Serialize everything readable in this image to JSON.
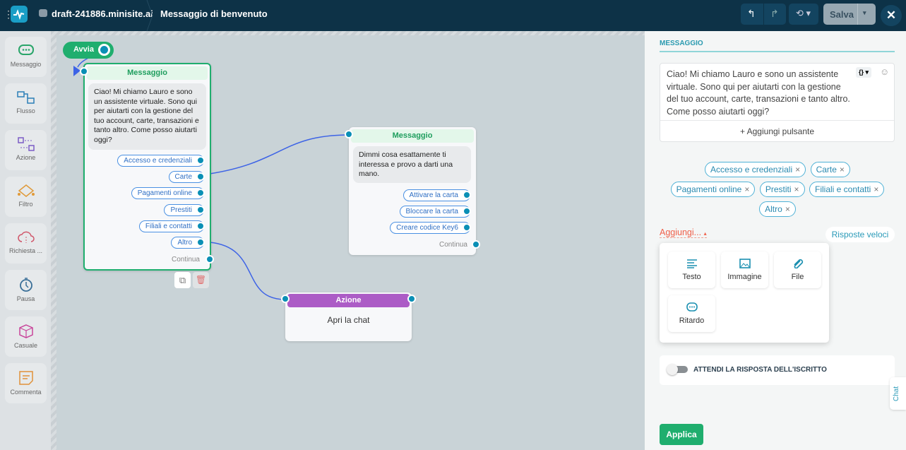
{
  "header": {
    "site": "draft-241886.minisite.ai",
    "page_title": "Messaggio di benvenuto",
    "save_label": "Salva"
  },
  "sidebar": {
    "items": [
      {
        "label": "Messaggio",
        "icon": "chat-bubble-icon"
      },
      {
        "label": "Flusso",
        "icon": "flow-icon"
      },
      {
        "label": "Azione",
        "icon": "action-icon"
      },
      {
        "label": "Filtro",
        "icon": "filter-icon"
      },
      {
        "label": "Richiesta ...",
        "icon": "cloud-request-icon"
      },
      {
        "label": "Pausa",
        "icon": "timer-icon"
      },
      {
        "label": "Casuale",
        "icon": "dice-icon"
      },
      {
        "label": "Commenta",
        "icon": "note-icon"
      }
    ]
  },
  "canvas": {
    "start_label": "Avvia",
    "node1": {
      "title": "Messaggio",
      "text": "Ciao! Mi chiamo Lauro e sono un assistente virtuale. Sono qui per aiutarti con la gestione del tuo account, carte, transazioni e tanto altro. Come posso aiutarti oggi?",
      "buttons": [
        "Accesso e credenziali",
        "Carte",
        "Pagamenti online",
        "Prestiti",
        "Filiali e contatti",
        "Altro"
      ],
      "continue": "Continua"
    },
    "node2": {
      "title": "Messaggio",
      "text": "Dimmi cosa esattamente ti interessa e provo a darti una mano.",
      "buttons": [
        "Attivare la carta",
        "Bloccare la carta",
        "Creare codice Key6"
      ],
      "continue": "Continua"
    },
    "node3": {
      "title": "Azione",
      "text": "Apri la chat"
    }
  },
  "panel": {
    "section_title": "MESSAGGIO",
    "message": "Ciao! Mi chiamo Lauro e sono un assistente virtuale. Sono qui per aiutarti con la gestione del tuo account, carte, transazioni e tanto altro. Come posso aiutarti oggi?",
    "variable_btn": "{}",
    "add_button": "+ Aggiungi pulsante",
    "chips": [
      "Accesso e credenziali",
      "Carte",
      "Pagamenti online",
      "Prestiti",
      "Filiali e contatti",
      "Altro"
    ],
    "chip_remove": "×",
    "add_menu": "Aggiungi...",
    "quick_replies": "Risposte veloci",
    "add_options": [
      "Testo",
      "Immagine",
      "File",
      "Ritardo"
    ],
    "wait_toggle": "ATTENDI LA RISPOSTA DELL'ISCRITTO",
    "wait_toggle_on": false,
    "chat_tab": "Chat",
    "apply": "Applica"
  },
  "colors": {
    "header": "#0d3247",
    "green": "#1fae6e",
    "purple": "#ac5cc6",
    "teal": "#0a8fb5"
  }
}
